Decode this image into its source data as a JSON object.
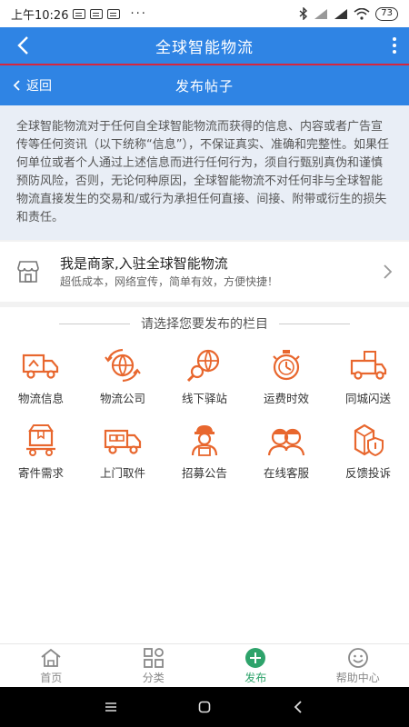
{
  "status_bar": {
    "time": "上午10:26",
    "dots": "···",
    "battery": "73"
  },
  "app_header": {
    "title": "全球智能物流"
  },
  "sub_header": {
    "back_label": "返回",
    "title": "发布帖子"
  },
  "notice": {
    "text": "全球智能物流对于任何自全球智能物流而获得的信息、内容或者广告宣传等任何资讯（以下统称“信息”），不保证真实、准确和完整性。如果任何单位或者个人通过上述信息而进行任何行为，须自行甄别真伪和谨慎预防风险，否则，无论何种原因，全球智能物流不对任何非与全球智能物流直接发生的交易和/或行为承担任何直接、间接、附带或衍生的损失和责任。"
  },
  "merchant": {
    "title": "我是商家,入驻全球智能物流",
    "subtitle": "超低成本，网络宣传，简单有效，方便快捷！"
  },
  "section": {
    "title": "请选择您要发布的栏目"
  },
  "categories": [
    {
      "label": "物流信息",
      "icon": "truck-icon"
    },
    {
      "label": "物流公司",
      "icon": "globe-arrows-icon"
    },
    {
      "label": "线下驿站",
      "icon": "globe-search-icon"
    },
    {
      "label": "运费时效",
      "icon": "stopwatch-icon"
    },
    {
      "label": "同城闪送",
      "icon": "fast-truck-icon"
    },
    {
      "label": "寄件需求",
      "icon": "box-cart-icon"
    },
    {
      "label": "上门取件",
      "icon": "pickup-truck-icon"
    },
    {
      "label": "招募公告",
      "icon": "courier-icon"
    },
    {
      "label": "在线客服",
      "icon": "support-agents-icon"
    },
    {
      "label": "反馈投诉",
      "icon": "box-shield-icon"
    }
  ],
  "tabbar": [
    {
      "label": "首页",
      "icon": "home-icon"
    },
    {
      "label": "分类",
      "icon": "grid-icon"
    },
    {
      "label": "发布",
      "icon": "plus-circle-icon",
      "active": true
    },
    {
      "label": "帮助中心",
      "icon": "smile-icon"
    }
  ],
  "colors": {
    "primary": "#2f84e4",
    "accent_red": "#d7263d",
    "icon_orange": "#e8672e",
    "active_green": "#2ea36b"
  }
}
